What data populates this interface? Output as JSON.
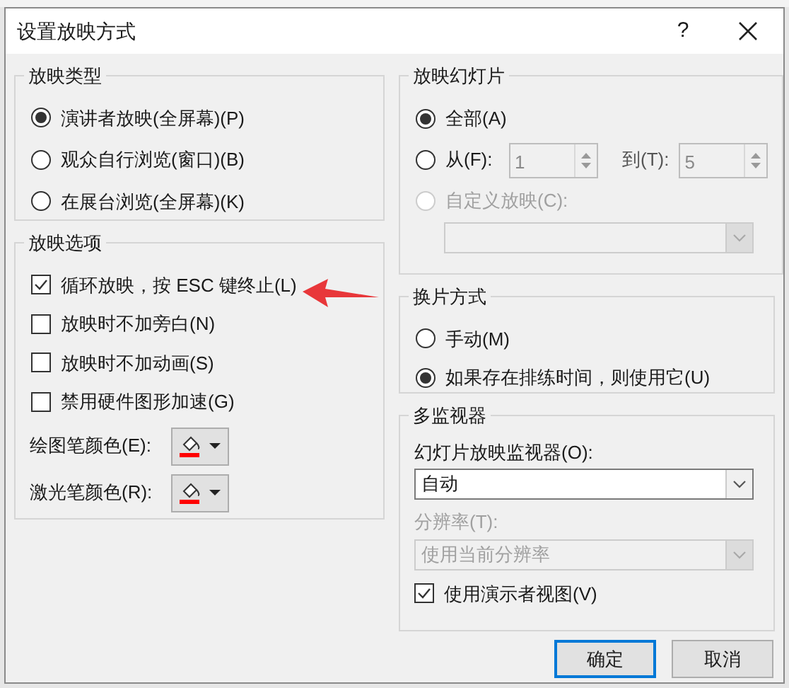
{
  "window": {
    "title": "设置放映方式",
    "help": "?"
  },
  "show_type": {
    "title": "放映类型",
    "options": [
      {
        "label": "演讲者放映(全屏幕)(P)",
        "selected": true
      },
      {
        "label": "观众自行浏览(窗口)(B)",
        "selected": false
      },
      {
        "label": "在展台浏览(全屏幕)(K)",
        "selected": false
      }
    ]
  },
  "show_options": {
    "title": "放映选项",
    "checkboxes": [
      {
        "label": "循环放映，按 ESC 键终止(L)",
        "checked": true
      },
      {
        "label": "放映时不加旁白(N)",
        "checked": false
      },
      {
        "label": "放映时不加动画(S)",
        "checked": false
      },
      {
        "label": "禁用硬件图形加速(G)",
        "checked": false
      }
    ],
    "pens": [
      {
        "label": "绘图笔颜色(E):"
      },
      {
        "label": "激光笔颜色(R):"
      }
    ]
  },
  "show_slides": {
    "title": "放映幻灯片",
    "options": [
      {
        "kind": "plain",
        "label": "全部(A)",
        "selected": true,
        "disabled": false
      },
      {
        "kind": "range",
        "label": "从(F):",
        "selected": false,
        "disabled": false,
        "from_value": "1",
        "to_label": "到(T):",
        "to_value": "5"
      },
      {
        "kind": "custom",
        "label": "自定义放映(C):",
        "selected": false,
        "disabled": true
      }
    ]
  },
  "advance": {
    "title": "换片方式",
    "options": [
      {
        "label": "手动(M)",
        "selected": false
      },
      {
        "label": "如果存在排练时间，则使用它(U)",
        "selected": true
      }
    ]
  },
  "monitors": {
    "title": "多监视器",
    "monitor_label": "幻灯片放映监视器(O):",
    "monitor_value": "自动",
    "resolution_label": "分辨率(T):",
    "resolution_value": "使用当前分辨率",
    "resolution_disabled": true,
    "presenter_view": {
      "label": "使用演示者视图(V)",
      "checked": true
    }
  },
  "buttons": [
    {
      "label": "确定",
      "default": true
    },
    {
      "label": "取消",
      "default": false
    }
  ]
}
